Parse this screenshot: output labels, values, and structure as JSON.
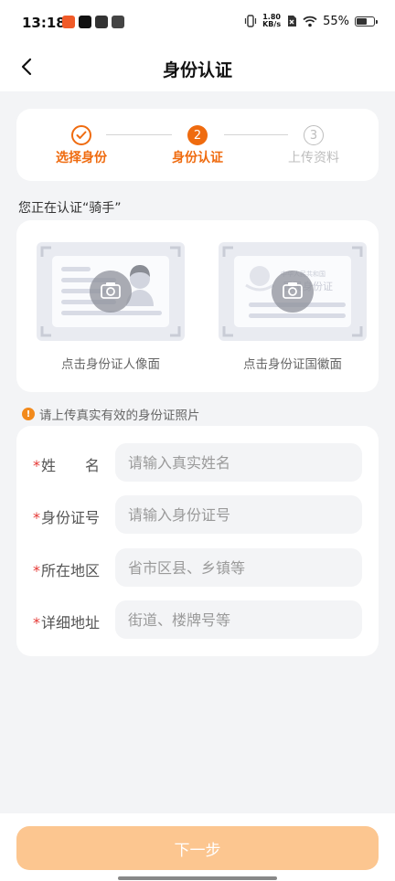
{
  "status_bar": {
    "time": "13:18",
    "net_speed_value": "1.80",
    "net_speed_unit": "KB/s",
    "battery_text": "55%",
    "battery_level": 0.55
  },
  "nav": {
    "title": "身份认证",
    "back_icon": "chevron-left-icon"
  },
  "steps": [
    {
      "number": "",
      "label": "选择身份",
      "state": "done"
    },
    {
      "number": "2",
      "label": "身份认证",
      "state": "active"
    },
    {
      "number": "3",
      "label": "上传资料",
      "state": "pending"
    }
  ],
  "hint": "您正在认证“骑手”",
  "id_upload": {
    "front_label": "点击身份证人像面",
    "back_label": "点击身份证国徽面",
    "back_card_line1": "中华人民共和国",
    "back_card_line2": "居民身份证"
  },
  "warning": "请上传真实有效的身份证照片",
  "form": {
    "required_mark": "*",
    "name_label": "姓　　名",
    "name_placeholder": "请输入真实姓名",
    "idno_label": "身份证号",
    "idno_placeholder": "请输入身份证号",
    "region_label": "所在地区",
    "region_placeholder": "省市区县、乡镇等",
    "address_label": "详细地址",
    "address_placeholder": "街道、楼牌号等"
  },
  "next_button_label": "下一步",
  "colors": {
    "accent": "#ef6b0f",
    "button": "#fcc690",
    "required": "#e53935",
    "pending": "#bdbdbd"
  }
}
